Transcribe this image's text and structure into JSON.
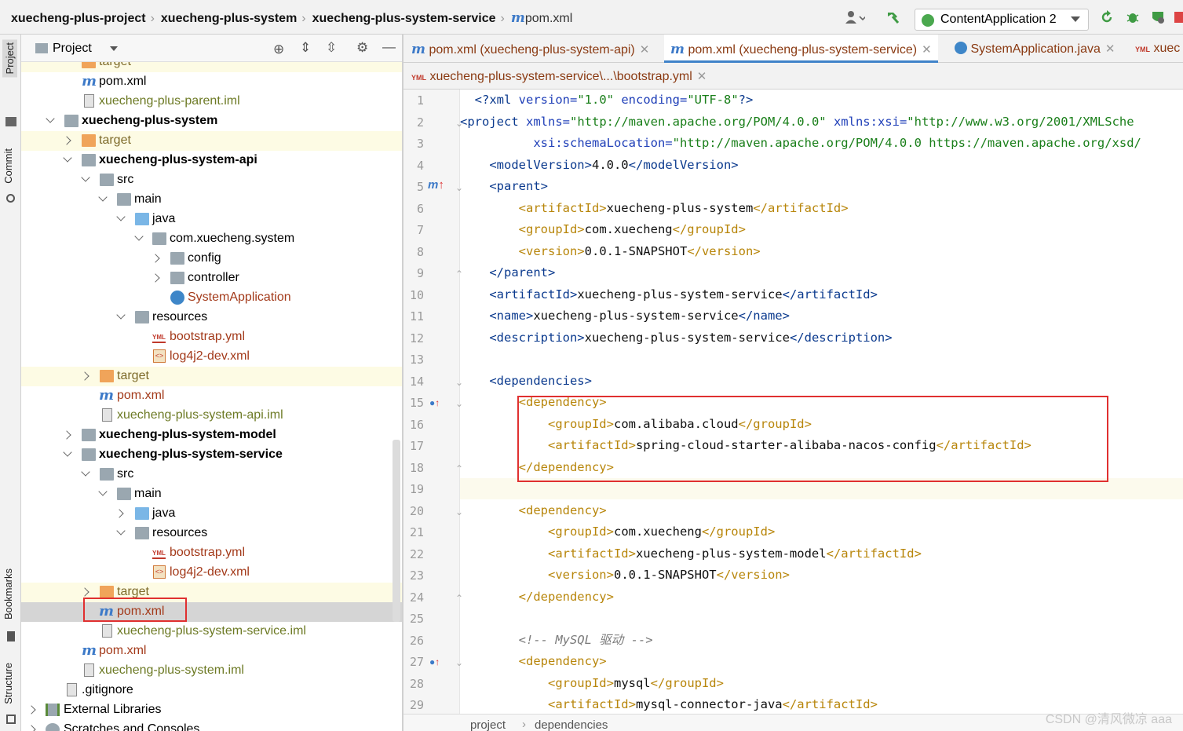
{
  "breadcrumbs": {
    "project": "xuecheng-plus-project",
    "system": "xuecheng-plus-system",
    "service": "xuecheng-plus-system-service",
    "file": "pom.xml"
  },
  "run_config": "ContentApplication 2",
  "stripe": {
    "project": "Project",
    "commit": "Commit",
    "bookmarks": "Bookmarks",
    "structure": "Structure"
  },
  "project_panel": {
    "title": "Project"
  },
  "tree": {
    "r0": "target",
    "r1": "pom.xml",
    "r2": "xuecheng-plus-parent.iml",
    "r3": "xuecheng-plus-system",
    "r4": "target",
    "r5": "xuecheng-plus-system-api",
    "r6": "src",
    "r7": "main",
    "r8": "java",
    "r9": "com.xuecheng.system",
    "r10": "config",
    "r11": "controller",
    "r12": "SystemApplication",
    "r13": "resources",
    "r14": "bootstrap.yml",
    "r15": "log4j2-dev.xml",
    "r16": "target",
    "r17": "pom.xml",
    "r18": "xuecheng-plus-system-api.iml",
    "r19": "xuecheng-plus-system-model",
    "r20": "xuecheng-plus-system-service",
    "r21": "src",
    "r22": "main",
    "r23": "java",
    "r24": "resources",
    "r25": "bootstrap.yml",
    "r26": "log4j2-dev.xml",
    "r27": "target",
    "r28": "pom.xml",
    "r29": "xuecheng-plus-system-service.iml",
    "r30": "pom.xml",
    "r31": "xuecheng-plus-system.iml",
    "r32": ".gitignore",
    "r33": "External Libraries",
    "r34": "Scratches and Consoles"
  },
  "tabs": {
    "t1": "pom.xml (xuecheng-plus-system-api)",
    "t2": "pom.xml (xuecheng-plus-system-service)",
    "t3": "SystemApplication.java",
    "t4": "xuec",
    "t5": "xuecheng-plus-system-service\\...\\bootstrap.yml"
  },
  "code": {
    "l1": {
      "n": "1",
      "a": "<?xml ",
      "b": "version=",
      "c": "\"1.0\" ",
      "d": "encoding=",
      "e": "\"UTF-8\"",
      "f": "?>"
    },
    "l2": {
      "n": "2",
      "a": "<project ",
      "b": "xmlns=",
      "c": "\"http://maven.apache.org/POM/4.0.0\" ",
      "d": "xmlns:xsi=",
      "e": "\"http://www.w3.org/2001/XMLSche"
    },
    "l3": {
      "n": "3",
      "b": "xsi:schemaLocation=",
      "c": "\"http://maven.apache.org/POM/4.0.0 https://maven.apache.org/xsd/"
    },
    "l4": {
      "n": "4",
      "a": "<modelVersion>",
      "t": "4.0.0",
      "z": "</modelVersion>"
    },
    "l5": {
      "n": "5",
      "a": "<parent>"
    },
    "l6": {
      "n": "6",
      "a": "<artifactId>",
      "t": "xuecheng-plus-system",
      "z": "</artifactId>"
    },
    "l7": {
      "n": "7",
      "a": "<groupId>",
      "t": "com.xuecheng",
      "z": "</groupId>"
    },
    "l8": {
      "n": "8",
      "a": "<version>",
      "t": "0.0.1-SNAPSHOT",
      "z": "</version>"
    },
    "l9": {
      "n": "9",
      "a": "</parent>"
    },
    "l10": {
      "n": "10",
      "a": "<artifactId>",
      "t": "xuecheng-plus-system-service",
      "z": "</artifactId>"
    },
    "l11": {
      "n": "11",
      "a": "<name>",
      "t": "xuecheng-plus-system-service",
      "z": "</name>"
    },
    "l12": {
      "n": "12",
      "a": "<description>",
      "t": "xuecheng-plus-system-service",
      "z": "</description>"
    },
    "l13": {
      "n": "13"
    },
    "l14": {
      "n": "14",
      "a": "<dependencies>"
    },
    "l15": {
      "n": "15",
      "a": "<dependency>"
    },
    "l16": {
      "n": "16",
      "a": "<groupId>",
      "t": "com.alibaba.cloud",
      "z": "</groupId>"
    },
    "l17": {
      "n": "17",
      "a": "<artifactId>",
      "t": "spring-cloud-starter-alibaba-nacos-config",
      "z": "</artifactId>"
    },
    "l18": {
      "n": "18",
      "a": "</dependency>"
    },
    "l19": {
      "n": "19"
    },
    "l20": {
      "n": "20",
      "a": "<dependency>"
    },
    "l21": {
      "n": "21",
      "a": "<groupId>",
      "t": "com.xuecheng",
      "z": "</groupId>"
    },
    "l22": {
      "n": "22",
      "a": "<artifactId>",
      "t": "xuecheng-plus-system-model",
      "z": "</artifactId>"
    },
    "l23": {
      "n": "23",
      "a": "<version>",
      "t": "0.0.1-SNAPSHOT",
      "z": "</version>"
    },
    "l24": {
      "n": "24",
      "a": "</dependency>"
    },
    "l25": {
      "n": "25"
    },
    "l26": {
      "n": "26",
      "a": "<!-- MySQL 驱动 -->"
    },
    "l27": {
      "n": "27",
      "a": "<dependency>"
    },
    "l28": {
      "n": "28",
      "a": "<groupId>",
      "t": "mysql",
      "z": "</groupId>"
    },
    "l29": {
      "n": "29",
      "a": "<artifactId>",
      "t": "mysql-connector-java",
      "z": "</artifactId>"
    }
  },
  "status": {
    "path1": "project",
    "path2": "dependencies"
  },
  "watermark": "CSDN @清风微凉 aaa",
  "colors": {
    "accent": "#4083c9",
    "highlight_box": "#e03030"
  }
}
